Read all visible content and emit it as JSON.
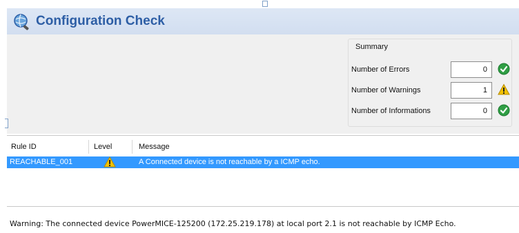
{
  "window": {
    "title": "Configuration Check",
    "title_icon": "search-globe-icon"
  },
  "summary": {
    "group_label": "Summary",
    "rows": [
      {
        "label": "Number of Errors",
        "value": "0",
        "status": "ok-check-icon",
        "status_color": "#2f9e44"
      },
      {
        "label": "Number of Warnings",
        "value": "1",
        "status": "warning-icon",
        "status_color": "#f2c200"
      },
      {
        "label": "Number of Informations",
        "value": "0",
        "status": "ok-check-icon",
        "status_color": "#2f9e44"
      }
    ]
  },
  "grid": {
    "columns": [
      "Rule ID",
      "Level",
      "Message"
    ],
    "rows": [
      {
        "rule_id": "REACHABLE_001",
        "level": "warning-icon",
        "message": "A Connected device is not reachable by a ICMP echo.",
        "selected": true
      }
    ],
    "selection_color": "#3399ff"
  },
  "status_bar": {
    "text": "Warning: The connected device PowerMICE-125200 (172.25.219.178) at local port 2.1 is not reachable by ICMP Echo."
  }
}
